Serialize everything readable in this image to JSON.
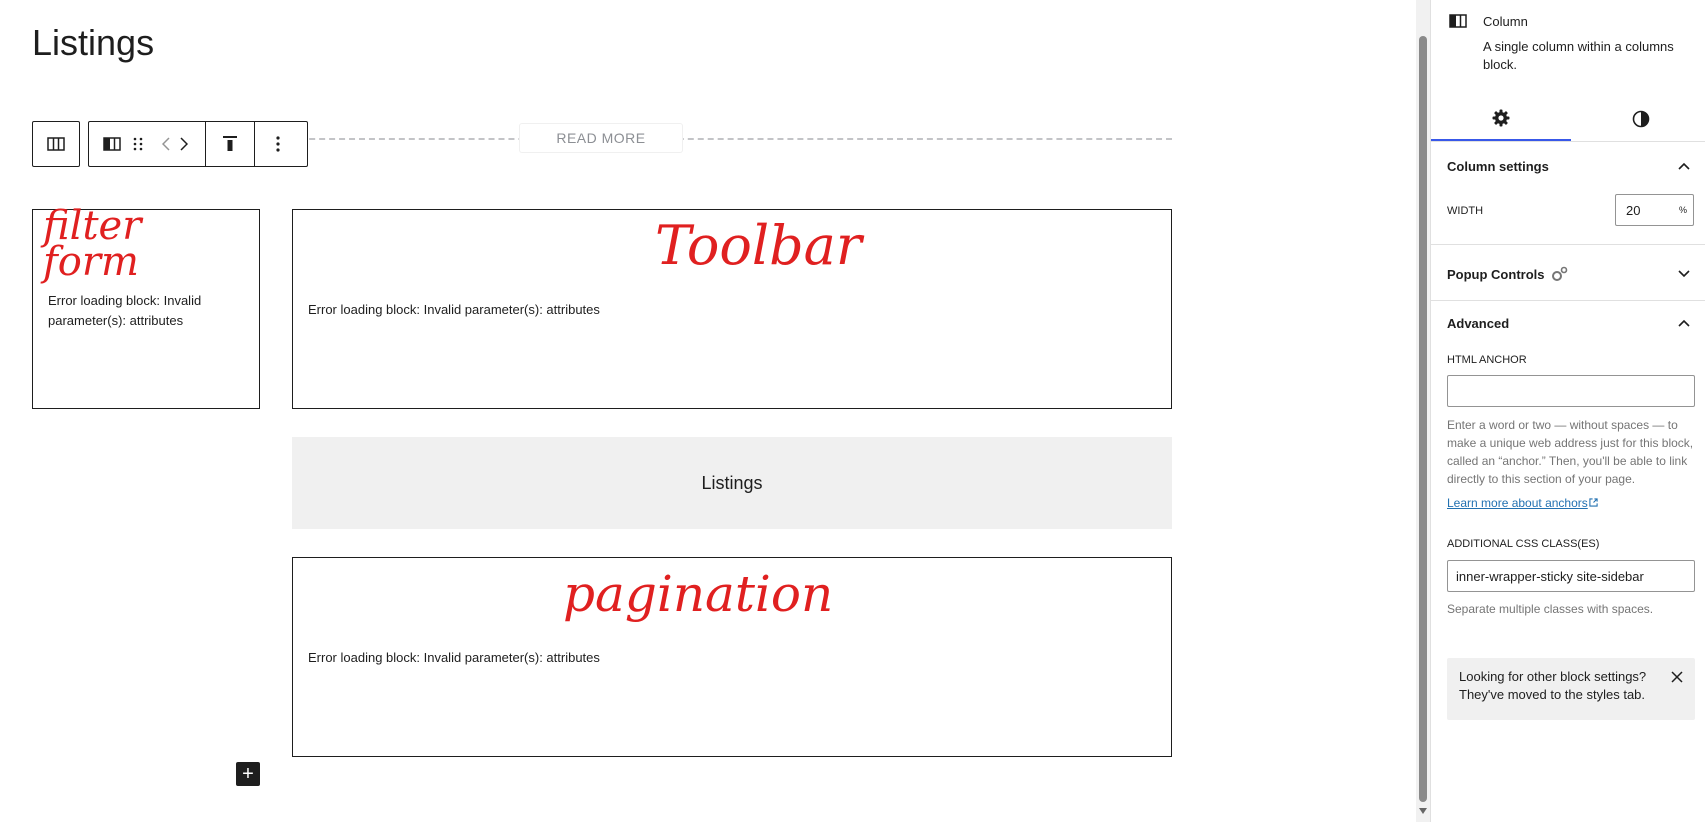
{
  "editor": {
    "page_title": "Listings",
    "read_more": "READ MORE",
    "blocks": {
      "filter_form": {
        "note": "filter form",
        "error": "Error loading block: Invalid parameter(s): attributes"
      },
      "toolbar": {
        "note": "Toolbar",
        "error": "Error loading block: Invalid parameter(s): attributes"
      },
      "listings": {
        "label": "Listings"
      },
      "pagination": {
        "note": "pagination",
        "error": "Error loading block: Invalid parameter(s): attributes"
      }
    },
    "add_block_symbol": "+"
  },
  "toolbar_icons": [
    "columns-icon",
    "column-icon",
    "drag-handle-icon",
    "move-left-icon",
    "move-right-icon",
    "vertical-align-top-icon",
    "more-options-icon"
  ],
  "sidebar": {
    "block_card": {
      "title": "Column",
      "description": "A single column within a columns block."
    },
    "tabs": [
      {
        "name": "settings",
        "icon": "gear-icon",
        "active": true
      },
      {
        "name": "styles",
        "icon": "contrast-icon",
        "active": false
      }
    ],
    "column_settings": {
      "title": "Column settings",
      "width_label": "WIDTH",
      "width_value": "20",
      "width_unit": "%"
    },
    "popup_controls": {
      "title": "Popup Controls"
    },
    "advanced": {
      "title": "Advanced",
      "html_anchor_label": "HTML ANCHOR",
      "html_anchor_value": "",
      "html_anchor_help": "Enter a word or two — without spaces — to make a unique web address just for this block, called an “anchor.” Then, you'll be able to link directly to this section of your page.",
      "learn_more": "Learn more about anchors",
      "css_class_label": "ADDITIONAL CSS CLASS(ES)",
      "css_class_value": "inner-wrapper-sticky site-sidebar",
      "css_class_help": "Separate multiple classes with spaces."
    },
    "notice": {
      "text": "Looking for other block settings? They've moved to the styles tab."
    }
  },
  "colors": {
    "accent": "#3858e9",
    "annotation": "#e02020",
    "link": "#2271b1"
  }
}
